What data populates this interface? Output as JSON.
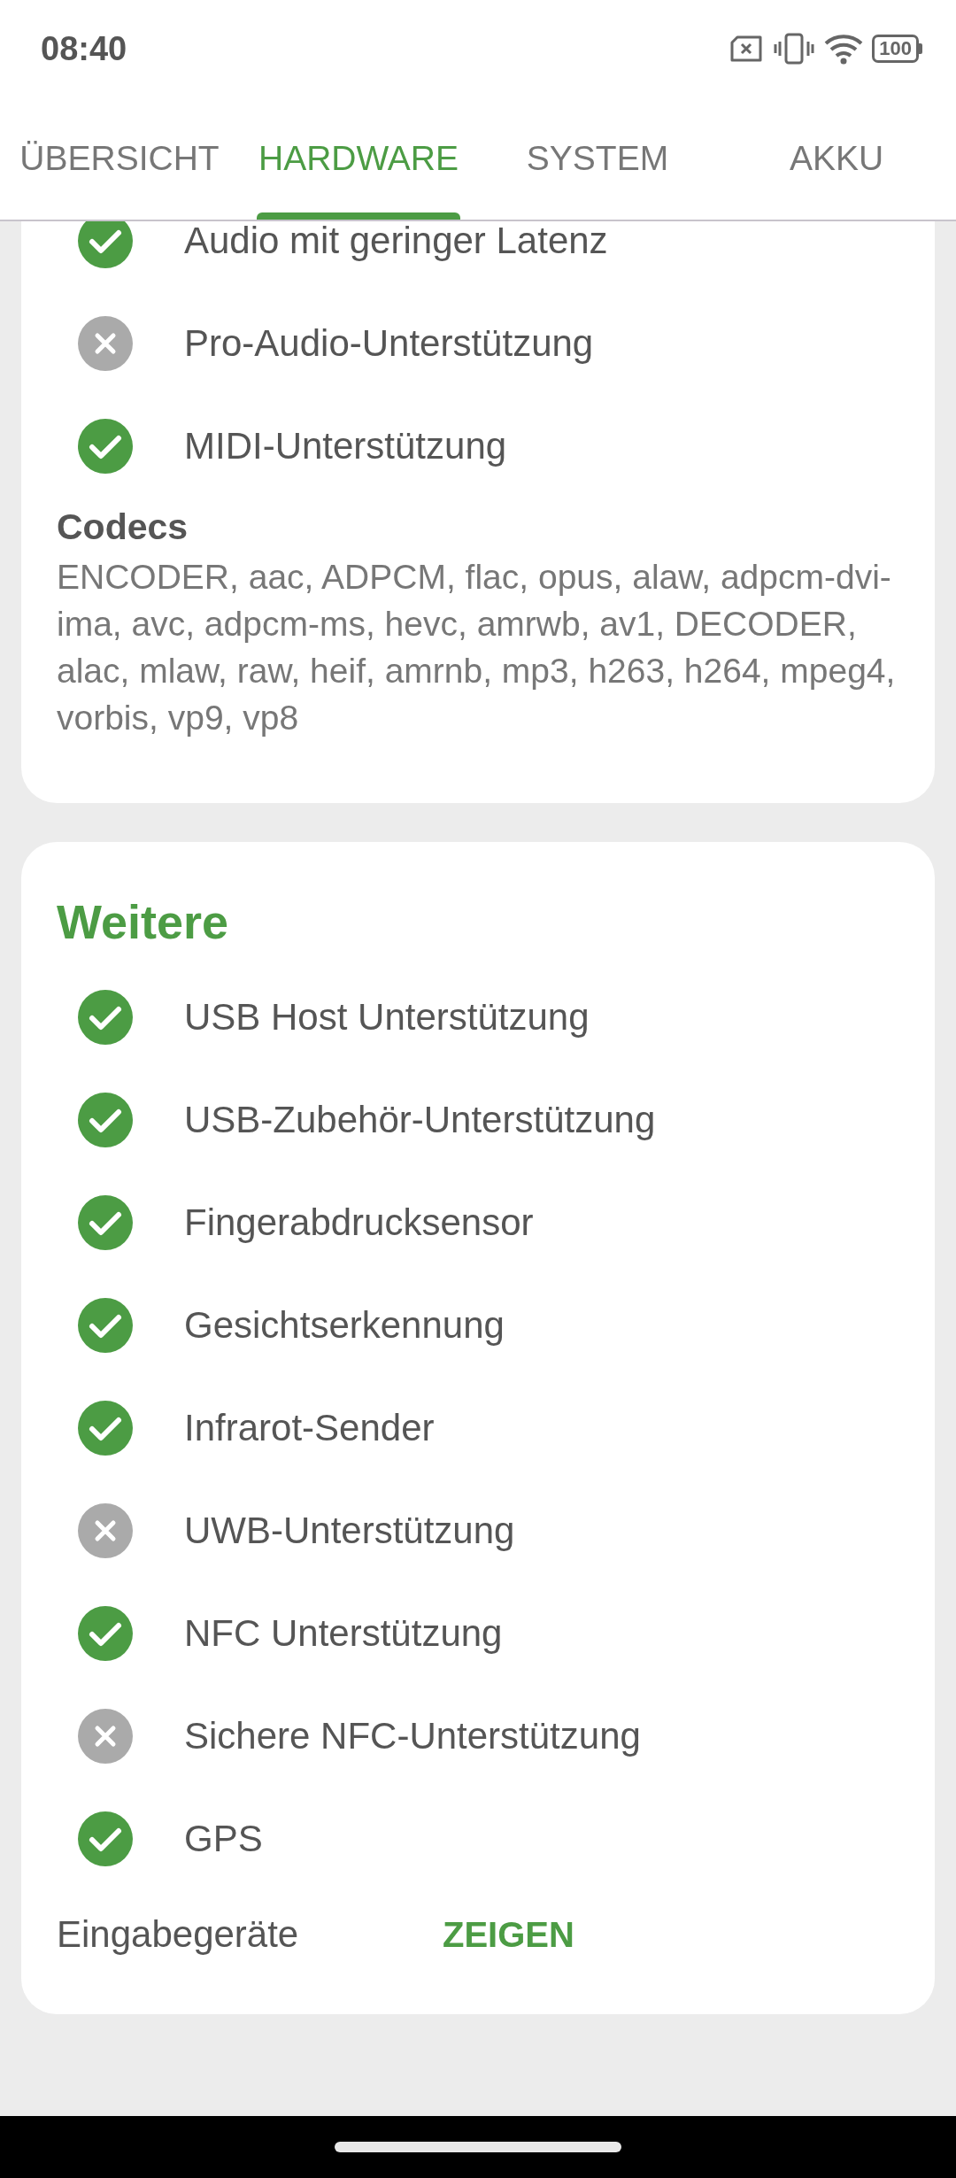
{
  "status_bar": {
    "time": "08:40",
    "battery": "100"
  },
  "tabs": [
    {
      "label": "ÜBERSICHT",
      "selected": false
    },
    {
      "label": "HARDWARE",
      "selected": true
    },
    {
      "label": "SYSTEM",
      "selected": false
    },
    {
      "label": "AKKU",
      "selected": false
    }
  ],
  "audio_card": {
    "features": [
      {
        "label": "Audio mit geringer Latenz",
        "supported": true
      },
      {
        "label": "Pro-Audio-Unterstützung",
        "supported": false
      },
      {
        "label": "MIDI-Unterstützung",
        "supported": true
      }
    ],
    "codecs_label": "Codecs",
    "codecs": "ENCODER, aac, ADPCM, flac, opus, alaw, adpcm-dvi-ima, avc, adpcm-ms, hevc, amrwb, av1, DECODER, alac, mlaw, raw, heif, amrnb, mp3, h263, h264, mpeg4, vorbis, vp9, vp8"
  },
  "other_card": {
    "title": "Weitere",
    "features": [
      {
        "label": "USB Host Unterstützung",
        "supported": true
      },
      {
        "label": "USB-Zubehör-Unterstützung",
        "supported": true
      },
      {
        "label": "Fingerabdrucksensor",
        "supported": true
      },
      {
        "label": "Gesichtserkennung",
        "supported": true
      },
      {
        "label": "Infrarot-Sender",
        "supported": true
      },
      {
        "label": "UWB-Unterstützung",
        "supported": false
      },
      {
        "label": "NFC Unterstützung",
        "supported": true
      },
      {
        "label": "Sichere NFC-Unterstützung",
        "supported": false
      },
      {
        "label": "GPS",
        "supported": true
      }
    ],
    "input_devices_label": "Eingabegeräte",
    "input_devices_button": "ZEIGEN"
  }
}
